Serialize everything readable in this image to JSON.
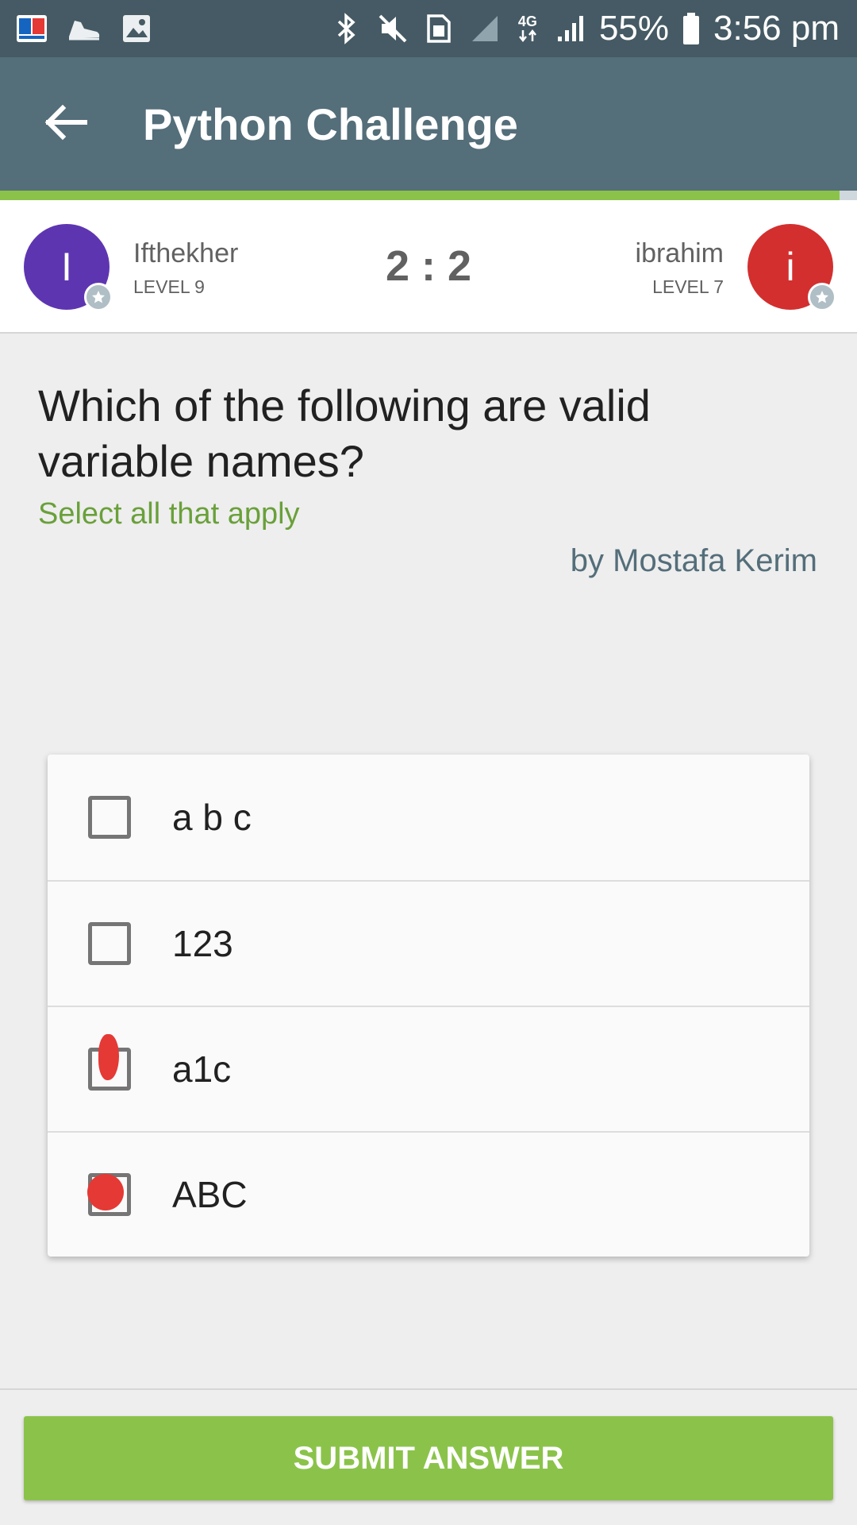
{
  "status_bar": {
    "battery": "55%",
    "time": "3:56 pm",
    "network": "4G",
    "left_icons": [
      "dictionary-app-icon",
      "shoe-app-icon",
      "gallery-icon"
    ],
    "right_icons": [
      "bluetooth-icon",
      "mute-icon",
      "sim-icon",
      "signal-icon",
      "data-4g-icon",
      "signal-bars-icon",
      "battery-icon"
    ]
  },
  "app_bar": {
    "title": "Python Challenge",
    "back_icon": "arrow-left-icon",
    "background": "#546e7a"
  },
  "match": {
    "player_left": {
      "initial": "I",
      "name": "Ifthekher",
      "level": "LEVEL 9",
      "color": "#5e35b1"
    },
    "player_right": {
      "initial": "i",
      "name": "ibrahim",
      "level": "LEVEL 7",
      "color": "#d32f2f"
    },
    "score": "2 : 2",
    "badge_icon": "star-icon"
  },
  "question": {
    "text": "Which of the following are valid variable names?",
    "hint": "Select all that apply",
    "author": "by Mostafa Kerim"
  },
  "options": [
    {
      "label": "a b c",
      "marked": false
    },
    {
      "label": "123",
      "marked": false
    },
    {
      "label": "a1c",
      "marked": true
    },
    {
      "label": "ABC",
      "marked": true
    }
  ],
  "submit": {
    "label": "SUBMIT ANSWER",
    "color": "#8bc34a"
  },
  "colors": {
    "accent_green": "#8bc34a",
    "hint_green": "#6aa03a",
    "mark_red": "#e53935"
  }
}
